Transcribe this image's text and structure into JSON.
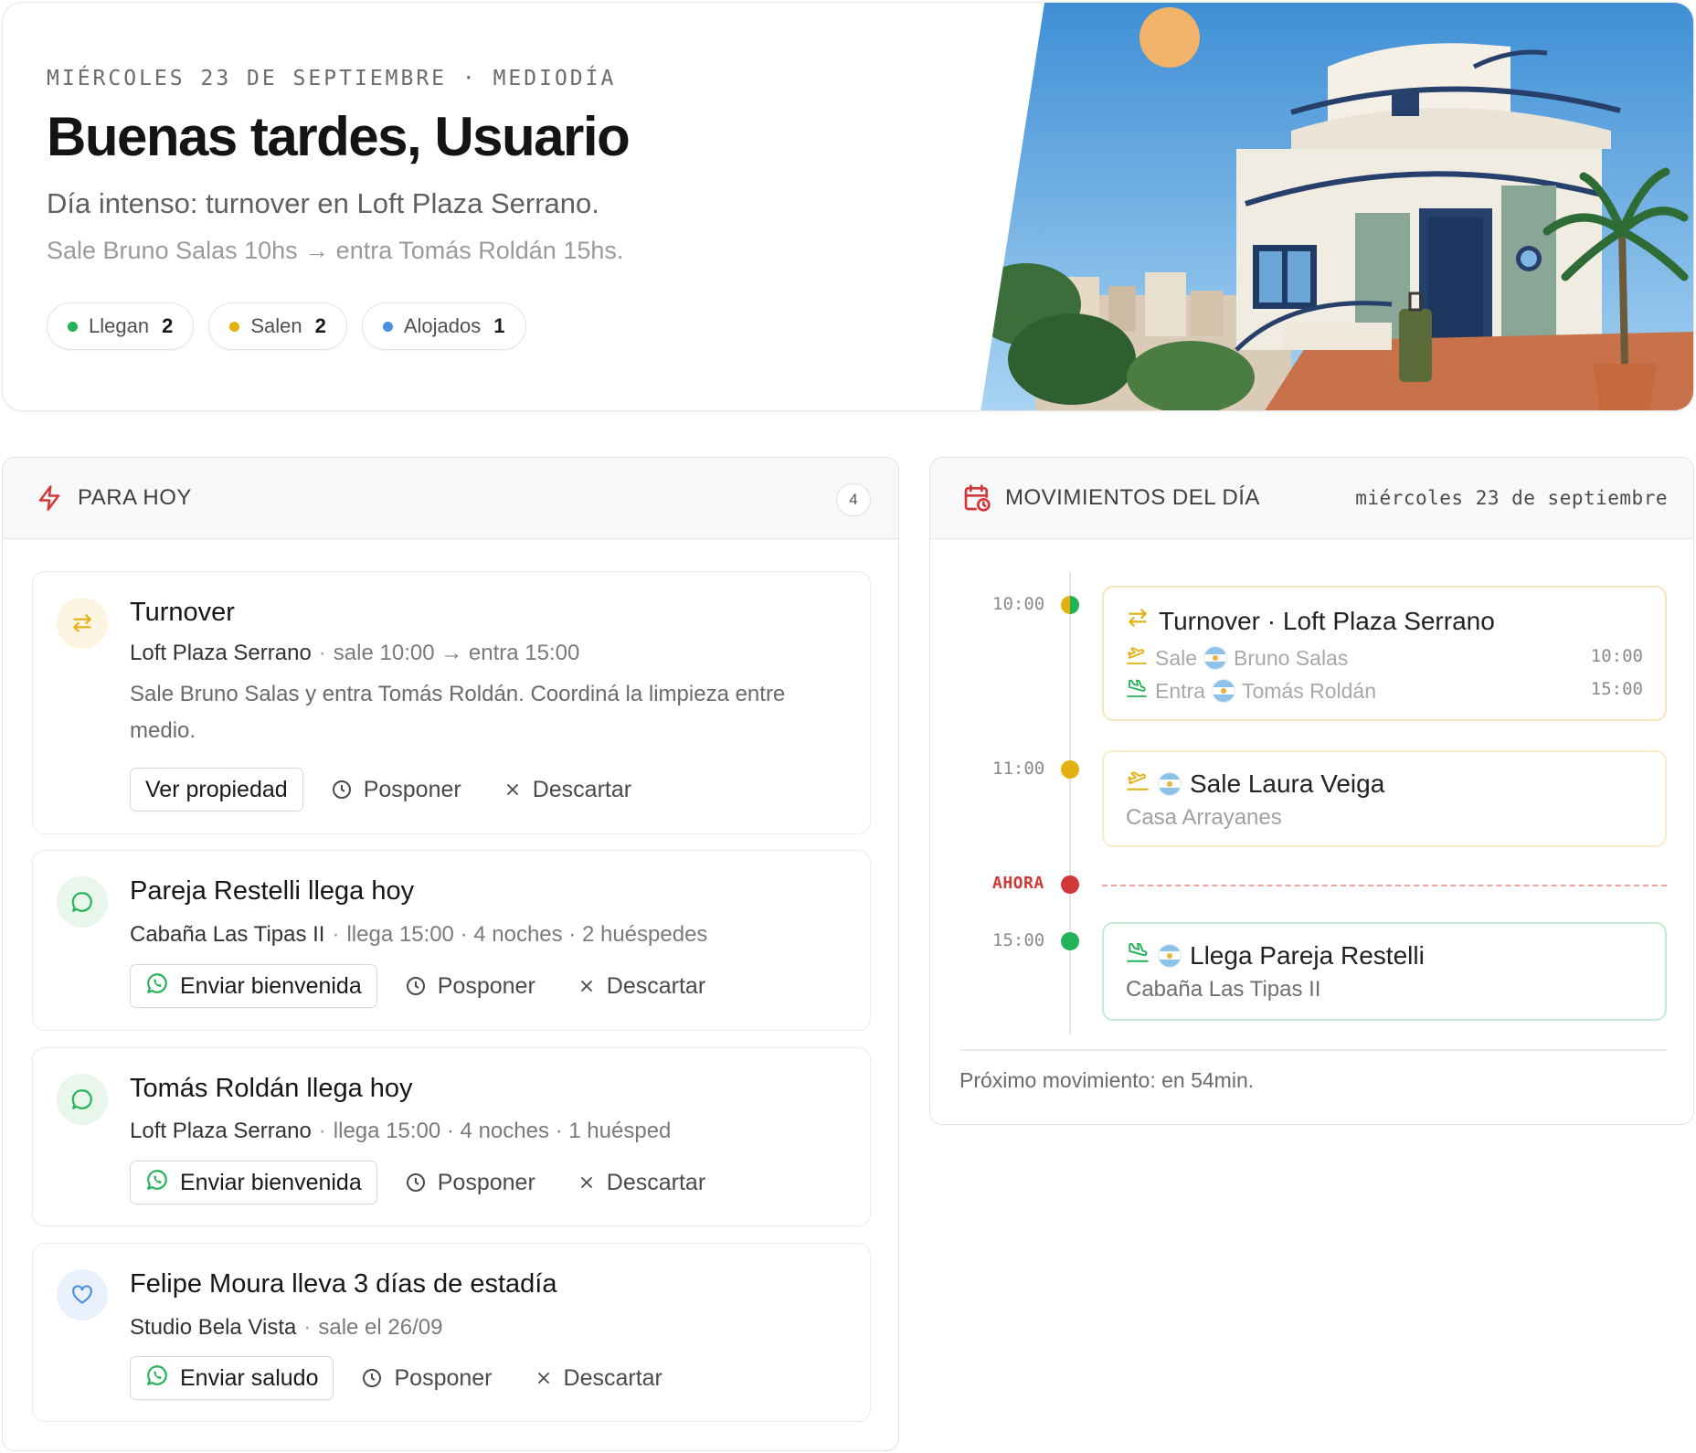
{
  "header": {
    "date_line": "MIÉRCOLES 23 DE SEPTIEMBRE · MEDIODÍA",
    "greeting": "Buenas tardes, Usuario",
    "summary": "Día intenso: turnover en Loft Plaza Serrano.",
    "detail": "Sale Bruno Salas 10hs → entra Tomás Roldán 15hs.",
    "stats": [
      {
        "label": "Llegan",
        "value": "2",
        "color": "#22b357"
      },
      {
        "label": "Salen",
        "value": "2",
        "color": "#e2b111"
      },
      {
        "label": "Alojados",
        "value": "1",
        "color": "#4a90e2"
      }
    ]
  },
  "today": {
    "title": "PARA HOY",
    "count": "4",
    "tasks": [
      {
        "title": "Turnover",
        "property": "Loft Plaza Serrano",
        "meta": "sale 10:00 → entra 15:00",
        "description": "Sale Bruno Salas y entra Tomás Roldán. Coordiná la limpieza entre medio.",
        "primary_action": "Ver propiedad",
        "icon": "swap-icon",
        "icon_color": "#e2b111"
      },
      {
        "title": "Pareja Restelli llega hoy",
        "property": "Cabaña Las Tipas II",
        "meta": "llega 15:00 · 4 noches · 2 huéspedes",
        "primary_action": "Enviar bienvenida",
        "icon": "chat-icon",
        "icon_color": "#22b357"
      },
      {
        "title": "Tomás Roldán llega hoy",
        "property": "Loft Plaza Serrano",
        "meta": "llega 15:00 · 4 noches · 1 huésped",
        "primary_action": "Enviar bienvenida",
        "icon": "chat-icon",
        "icon_color": "#22b357"
      },
      {
        "title": "Felipe Moura lleva 3 días de estadía",
        "property": "Studio Bela Vista",
        "meta": "sale el 26/09",
        "primary_action": "Enviar saludo",
        "icon": "heart-icon",
        "icon_color": "#4a90e2"
      }
    ],
    "postpone_label": "Posponer",
    "dismiss_label": "Descartar"
  },
  "movements": {
    "title": "MOVIMIENTOS DEL DÍA",
    "date": "miércoles 23 de septiembre",
    "now_label": "AHORA",
    "events": [
      {
        "time": "10:00",
        "title": "Turnover · Loft Plaza Serrano",
        "rows": [
          {
            "kind": "Sale",
            "guest": "Bruno Salas",
            "time": "10:00"
          },
          {
            "kind": "Entra",
            "guest": "Tomás Roldán",
            "time": "15:00"
          }
        ]
      },
      {
        "time": "11:00",
        "title": "Sale Laura Veiga",
        "property": "Casa Arrayanes"
      },
      {
        "time": "15:00",
        "title": "Llega Pareja Restelli",
        "property": "Cabaña Las Tipas II"
      }
    ],
    "next": "Próximo movimiento: en 54min."
  },
  "colors": {
    "arrival": "#22b357",
    "departure": "#e2b111",
    "stay": "#4a90e2",
    "now": "#d23737"
  }
}
